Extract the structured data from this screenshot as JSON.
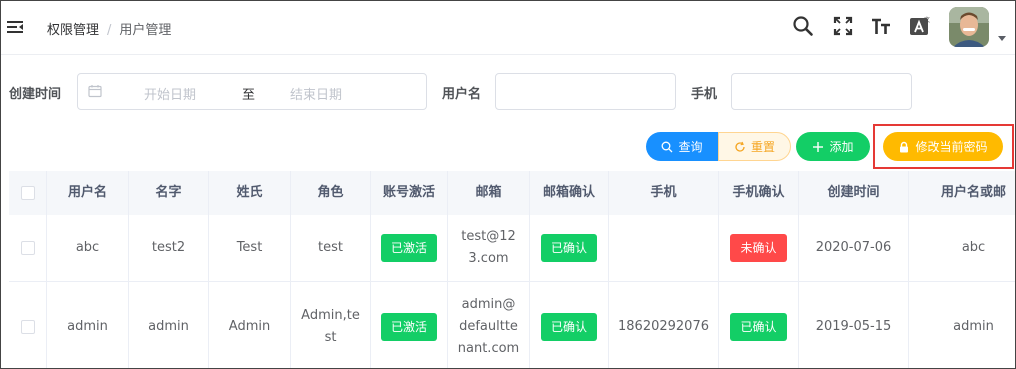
{
  "breadcrumb": {
    "parent": "权限管理",
    "separator": "/",
    "current": "用户管理"
  },
  "filters": {
    "created_label": "创建时间",
    "start_placeholder": "开始日期",
    "range_separator": "至",
    "end_placeholder": "结束日期",
    "username_label": "用户名",
    "username_value": "",
    "phone_label": "手机",
    "phone_value": ""
  },
  "buttons": {
    "query": "查询",
    "reset": "重置",
    "add": "添加",
    "change_password": "修改当前密码"
  },
  "table": {
    "headers": [
      "用户名",
      "名字",
      "姓氏",
      "角色",
      "账号激活",
      "邮箱",
      "邮箱确认",
      "手机",
      "手机确认",
      "创建时间",
      "用户名或邮"
    ],
    "rows": [
      {
        "username": "abc",
        "name": "test2",
        "surname": "Test",
        "role": "test",
        "active": "已激活",
        "email_l1": "test@12",
        "email_l2": "3.com",
        "email_l3": "",
        "email_confirmed": "已确认",
        "phone": "",
        "phone_confirmed": "未确认",
        "created": "2020-07-06",
        "login": "abc"
      },
      {
        "username": "admin",
        "name": "admin",
        "surname": "Admin",
        "role_l1": "Admin,te",
        "role_l2": "st",
        "active": "已激活",
        "email_l1": "admin@",
        "email_l2": "defaultte",
        "email_l3": "nant.com",
        "email_confirmed": "已确认",
        "phone": "18620292076",
        "phone_confirmed": "已确认",
        "created": "2019-05-15",
        "login": "admin"
      }
    ]
  },
  "colors": {
    "primary": "#1890ff",
    "success": "#13ce66",
    "danger": "#ff4949",
    "warning": "#ffba00",
    "highlight": "#e53935"
  }
}
